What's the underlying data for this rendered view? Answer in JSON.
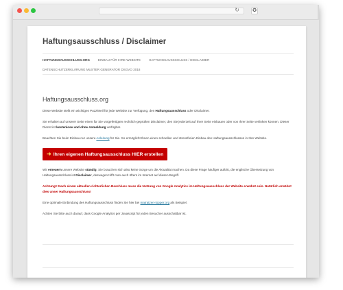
{
  "browser": {
    "reload_glyph": "↻",
    "download_glyph": "✪",
    "new_tab_glyph": "+"
  },
  "site": {
    "title": "Haftungsausschluss / Disclaimer"
  },
  "nav": {
    "items": [
      "HAFTUNGSAUSSCHLUSS.ORG",
      "EINBAU FÜR IHRE WEBSITE",
      "HAFTUNGSAUSSCHLUSS / DISCLAIMER"
    ],
    "row2": "DATENSCHUTZERKLÄRUNG MUSTER GENERATOR DSGVO 2018"
  },
  "content": {
    "title": "Haftungsausschluss.org",
    "p1_a": "Diese Website stellt ein wichtiges Puzzleteil für jede Website zur Verfügung, den ",
    "p1_b": "Haftungsausschluss",
    "p1_c": " oder Disclaimer.",
    "p2_a": "Sie erhalten auf unserer Seite einen für Sie vorgefertigten rechtlich-geprüften Disclaimer, den Sie jederzeit auf Ihrer Seite einbauen oder von Ihrer Seite verlinken können. Dieser Dienst ist ",
    "p2_b": "kostenlose und ohne Anmeldung",
    "p2_c": " verfügbar.",
    "p3_a": "Beachten Sie beim Einbau nur unsere ",
    "p3_link": "Anleitung",
    "p3_b": " für Sie. So ermöglicht Ihnen einen schnellen und stressfreien Einbau des Haftungsausschlusses in Ihre Website.",
    "cta_arrow": "➜",
    "cta_label": "Ihren eigenen Haftungsausschluss HIER erstellen",
    "p4_a": "Wir ",
    "p4_b": "erneuern",
    "p4_c": " unsere Website ",
    "p4_d": "ständig",
    "p4_e": ". Sie brauchen sich also keine Sorge um die Aktualität machen. Da diese Frage häufiger auftritt, die englische Übersetzung von Haftungsausschluss ist ",
    "p4_f": "Disclaimer",
    "p4_g": ", deswegen trifft man auch öfters im Internet auf diesen Begriff.",
    "warning": "Achtung!! Nach einem aktuellen richterlichen Beschluss muss die Nutzung von Google Analytics im Haftungsausschluss der Website erwähnt sein. Natürlich erwähnt dies unser Haftungsausschluss!",
    "p5_a": "Eine optimale Einbindung des Haftungsausschluss finden Sie hier bei ",
    "p5_link": "matratzen-topper.org",
    "p5_b": " als Beispiel.",
    "p6": "Achten Sie bitte auch darauf, dass Google Analytics per Javascript für jeden Besucher ausschaltbar ist."
  }
}
